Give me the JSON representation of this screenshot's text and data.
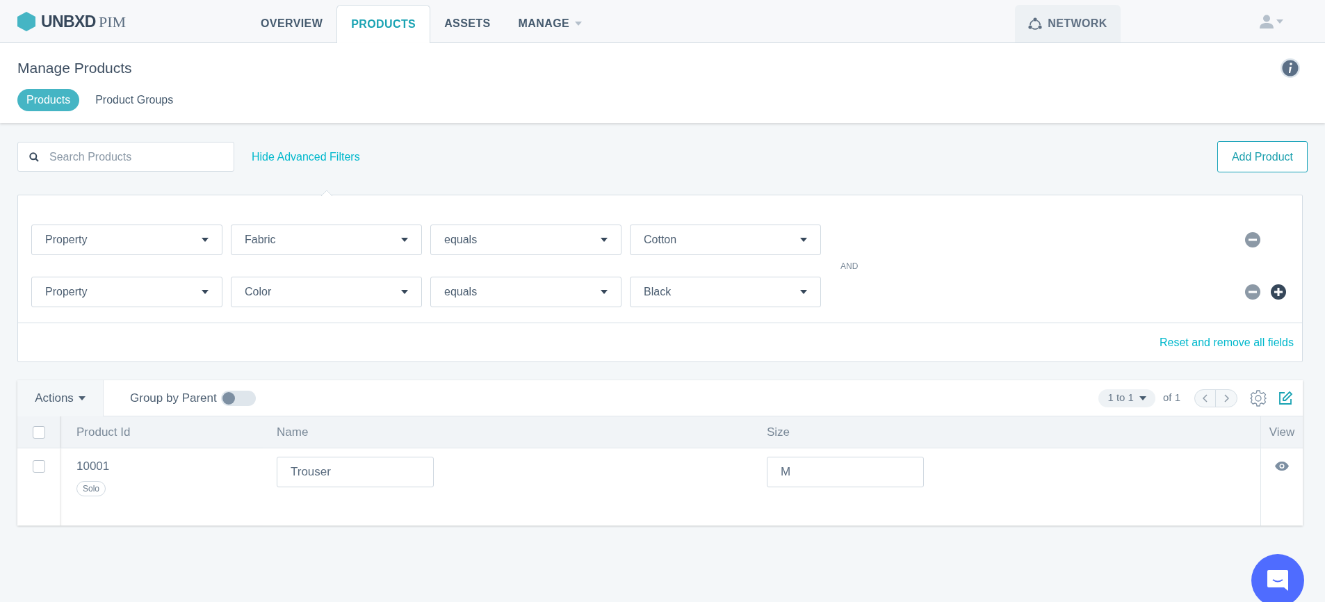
{
  "topbar": {
    "logo": {
      "brand": "UNBXD",
      "product": "PIM"
    },
    "tabs": [
      {
        "label": "OVERVIEW",
        "selected": false,
        "dropdown": false
      },
      {
        "label": "PRODUCTS",
        "selected": true,
        "dropdown": false
      },
      {
        "label": "ASSETS",
        "selected": false,
        "dropdown": false
      },
      {
        "label": "MANAGE",
        "selected": false,
        "dropdown": true
      }
    ],
    "network": {
      "label": "NETWORK"
    }
  },
  "header": {
    "title": "Manage Products",
    "subtabs": [
      {
        "label": "Products",
        "selected": true
      },
      {
        "label": "Product Groups",
        "selected": false
      }
    ]
  },
  "search": {
    "placeholder": "Search Products"
  },
  "filter_toggle": "Hide Advanced Filters",
  "add_button": "Add Product",
  "filters": {
    "rows": [
      {
        "fields": [
          "Property",
          "Fabric",
          "equals",
          "Cotton"
        ],
        "can_add": false
      },
      {
        "fields": [
          "Property",
          "Color",
          "equals",
          "Black"
        ],
        "can_add": true
      }
    ],
    "connector": "AND",
    "reset": "Reset and remove all fields"
  },
  "table": {
    "actions": "Actions",
    "group_by_parent": {
      "label": "Group by Parent",
      "on": false
    },
    "pagination": {
      "range": "1 to 1",
      "total": "of 1"
    },
    "all_checked": false,
    "columns": [
      "Product Id",
      "Name",
      "Size",
      "View"
    ],
    "rows": [
      {
        "checked": false,
        "id": "10001",
        "tag": "Solo",
        "name": "Trouser",
        "size": "M"
      }
    ]
  }
}
